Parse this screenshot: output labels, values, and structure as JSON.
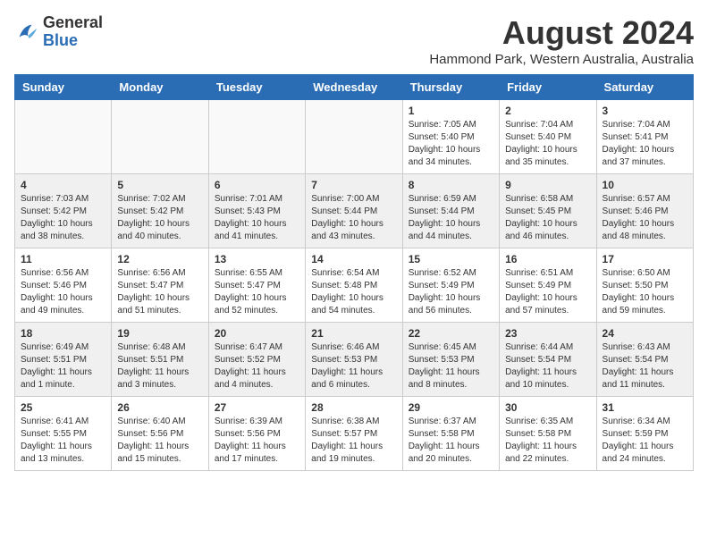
{
  "header": {
    "logo_general": "General",
    "logo_blue": "Blue",
    "month_year": "August 2024",
    "location": "Hammond Park, Western Australia, Australia"
  },
  "weekdays": [
    "Sunday",
    "Monday",
    "Tuesday",
    "Wednesday",
    "Thursday",
    "Friday",
    "Saturday"
  ],
  "weeks": [
    [
      {
        "day": "",
        "empty": true
      },
      {
        "day": "",
        "empty": true
      },
      {
        "day": "",
        "empty": true
      },
      {
        "day": "",
        "empty": true
      },
      {
        "day": "1",
        "rise": "7:05 AM",
        "set": "5:40 PM",
        "hours": "10 hours",
        "mins": "34 minutes"
      },
      {
        "day": "2",
        "rise": "7:04 AM",
        "set": "5:40 PM",
        "hours": "10 hours",
        "mins": "35 minutes"
      },
      {
        "day": "3",
        "rise": "7:04 AM",
        "set": "5:41 PM",
        "hours": "10 hours",
        "mins": "37 minutes"
      }
    ],
    [
      {
        "day": "4",
        "rise": "7:03 AM",
        "set": "5:42 PM",
        "hours": "10 hours",
        "mins": "38 minutes"
      },
      {
        "day": "5",
        "rise": "7:02 AM",
        "set": "5:42 PM",
        "hours": "10 hours",
        "mins": "40 minutes"
      },
      {
        "day": "6",
        "rise": "7:01 AM",
        "set": "5:43 PM",
        "hours": "10 hours",
        "mins": "41 minutes"
      },
      {
        "day": "7",
        "rise": "7:00 AM",
        "set": "5:44 PM",
        "hours": "10 hours",
        "mins": "43 minutes"
      },
      {
        "day": "8",
        "rise": "6:59 AM",
        "set": "5:44 PM",
        "hours": "10 hours",
        "mins": "44 minutes"
      },
      {
        "day": "9",
        "rise": "6:58 AM",
        "set": "5:45 PM",
        "hours": "10 hours",
        "mins": "46 minutes"
      },
      {
        "day": "10",
        "rise": "6:57 AM",
        "set": "5:46 PM",
        "hours": "10 hours",
        "mins": "48 minutes"
      }
    ],
    [
      {
        "day": "11",
        "rise": "6:56 AM",
        "set": "5:46 PM",
        "hours": "10 hours",
        "mins": "49 minutes"
      },
      {
        "day": "12",
        "rise": "6:56 AM",
        "set": "5:47 PM",
        "hours": "10 hours",
        "mins": "51 minutes"
      },
      {
        "day": "13",
        "rise": "6:55 AM",
        "set": "5:47 PM",
        "hours": "10 hours",
        "mins": "52 minutes"
      },
      {
        "day": "14",
        "rise": "6:54 AM",
        "set": "5:48 PM",
        "hours": "10 hours",
        "mins": "54 minutes"
      },
      {
        "day": "15",
        "rise": "6:52 AM",
        "set": "5:49 PM",
        "hours": "10 hours",
        "mins": "56 minutes"
      },
      {
        "day": "16",
        "rise": "6:51 AM",
        "set": "5:49 PM",
        "hours": "10 hours",
        "mins": "57 minutes"
      },
      {
        "day": "17",
        "rise": "6:50 AM",
        "set": "5:50 PM",
        "hours": "10 hours",
        "mins": "59 minutes"
      }
    ],
    [
      {
        "day": "18",
        "rise": "6:49 AM",
        "set": "5:51 PM",
        "hours": "11 hours",
        "mins": "1 minute"
      },
      {
        "day": "19",
        "rise": "6:48 AM",
        "set": "5:51 PM",
        "hours": "11 hours",
        "mins": "3 minutes"
      },
      {
        "day": "20",
        "rise": "6:47 AM",
        "set": "5:52 PM",
        "hours": "11 hours",
        "mins": "4 minutes"
      },
      {
        "day": "21",
        "rise": "6:46 AM",
        "set": "5:53 PM",
        "hours": "11 hours",
        "mins": "6 minutes"
      },
      {
        "day": "22",
        "rise": "6:45 AM",
        "set": "5:53 PM",
        "hours": "11 hours",
        "mins": "8 minutes"
      },
      {
        "day": "23",
        "rise": "6:44 AM",
        "set": "5:54 PM",
        "hours": "11 hours",
        "mins": "10 minutes"
      },
      {
        "day": "24",
        "rise": "6:43 AM",
        "set": "5:54 PM",
        "hours": "11 hours",
        "mins": "11 minutes"
      }
    ],
    [
      {
        "day": "25",
        "rise": "6:41 AM",
        "set": "5:55 PM",
        "hours": "11 hours",
        "mins": "13 minutes"
      },
      {
        "day": "26",
        "rise": "6:40 AM",
        "set": "5:56 PM",
        "hours": "11 hours",
        "mins": "15 minutes"
      },
      {
        "day": "27",
        "rise": "6:39 AM",
        "set": "5:56 PM",
        "hours": "11 hours",
        "mins": "17 minutes"
      },
      {
        "day": "28",
        "rise": "6:38 AM",
        "set": "5:57 PM",
        "hours": "11 hours",
        "mins": "19 minutes"
      },
      {
        "day": "29",
        "rise": "6:37 AM",
        "set": "5:58 PM",
        "hours": "11 hours",
        "mins": "20 minutes"
      },
      {
        "day": "30",
        "rise": "6:35 AM",
        "set": "5:58 PM",
        "hours": "11 hours",
        "mins": "22 minutes"
      },
      {
        "day": "31",
        "rise": "6:34 AM",
        "set": "5:59 PM",
        "hours": "11 hours",
        "mins": "24 minutes"
      }
    ]
  ]
}
